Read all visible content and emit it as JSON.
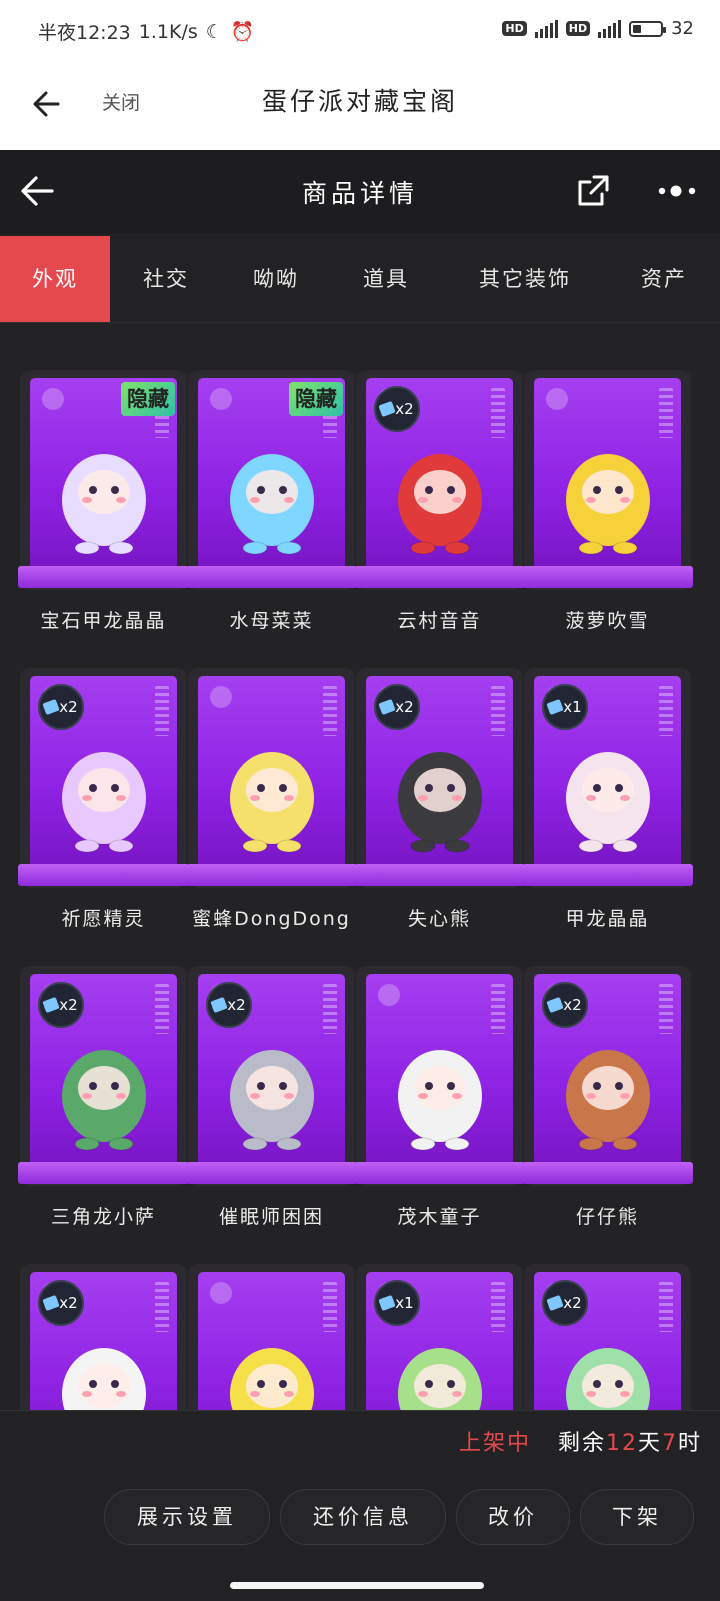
{
  "status_bar": {
    "time": "半夜12:23",
    "speed": "1.1K/s",
    "battery": "32",
    "battery_level": 0.32,
    "hd1": "HD",
    "hd2": "HD"
  },
  "app_bar": {
    "close_label": "关闭",
    "title": "蛋仔派对藏宝阁"
  },
  "page_header": {
    "title": "商品详情"
  },
  "tabs": [
    {
      "label": "外观",
      "active": true
    },
    {
      "label": "社交",
      "active": false
    },
    {
      "label": "呦呦",
      "active": false
    },
    {
      "label": "道具",
      "active": false
    },
    {
      "label": "其它装饰",
      "active": false
    },
    {
      "label": "资产",
      "active": false
    }
  ],
  "items": [
    {
      "name": "宝石甲龙晶晶",
      "badge": "隐藏",
      "count": "",
      "color": "#e8dcff"
    },
    {
      "name": "水母菜菜",
      "badge": "隐藏",
      "count": "",
      "color": "#7fd6ff"
    },
    {
      "name": "云村音音",
      "badge": "",
      "count": "x2",
      "color": "#e03a3a"
    },
    {
      "name": "菠萝吹雪",
      "badge": "",
      "count": "",
      "color": "#f6d13a"
    },
    {
      "name": "祈愿精灵",
      "badge": "",
      "count": "x2",
      "color": "#e9c8ff"
    },
    {
      "name": "蜜蜂DongDong",
      "badge": "",
      "count": "",
      "color": "#f4e06a"
    },
    {
      "name": "失心熊",
      "badge": "",
      "count": "x2",
      "color": "#3b3b3f"
    },
    {
      "name": "甲龙晶晶",
      "badge": "",
      "count": "x1",
      "color": "#f5e4ee"
    },
    {
      "name": "三角龙小萨",
      "badge": "",
      "count": "x2",
      "color": "#5aa86a"
    },
    {
      "name": "催眠师困困",
      "badge": "",
      "count": "x2",
      "color": "#b9bcc8"
    },
    {
      "name": "茂木童子",
      "badge": "",
      "count": "",
      "color": "#f2f2f2"
    },
    {
      "name": "仔仔熊",
      "badge": "",
      "count": "x2",
      "color": "#c9774a"
    },
    {
      "name": "",
      "badge": "",
      "count": "x2",
      "color": "#f4f4f4"
    },
    {
      "name": "",
      "badge": "",
      "count": "",
      "color": "#f6e04a"
    },
    {
      "name": "",
      "badge": "",
      "count": "x1",
      "color": "#a6e08a"
    },
    {
      "name": "",
      "badge": "",
      "count": "x2",
      "color": "#9fe0a8"
    }
  ],
  "footer": {
    "status": "上架中",
    "remaining_prefix": "剩余",
    "days": "12",
    "day_unit": "天",
    "hours": "7",
    "hour_unit": "时",
    "buttons": [
      "展示设置",
      "还价信息",
      "改价",
      "下架"
    ]
  }
}
